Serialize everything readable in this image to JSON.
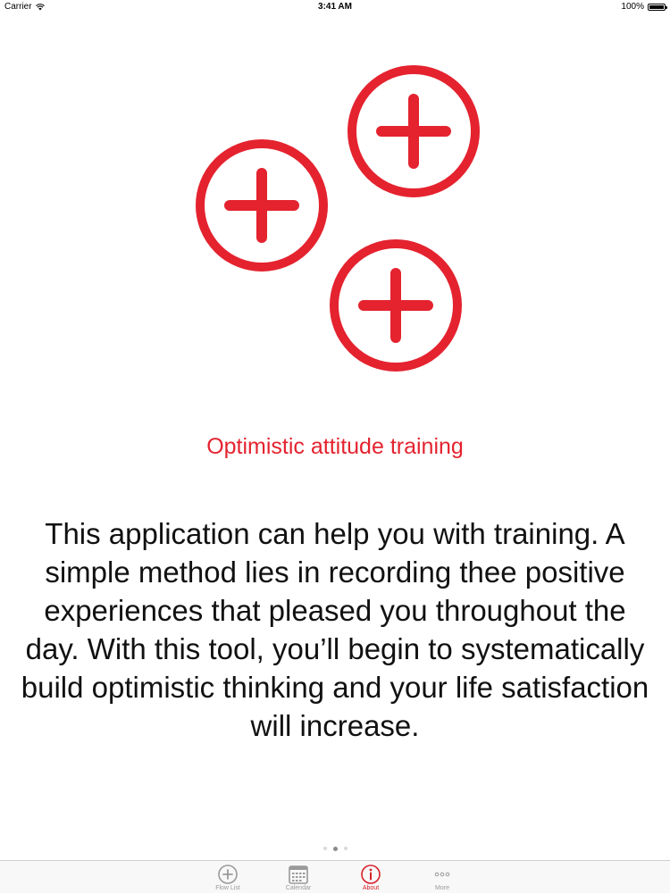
{
  "status_bar": {
    "carrier": "Carrier",
    "time": "3:41 AM",
    "battery": "100%",
    "battery_level": 1.0
  },
  "logo": {
    "icon": "three-plus-circles-icon",
    "color": "#e4232f"
  },
  "title": "Optimistic attitude training",
  "description": "This application can help you with training. A simple method lies in recording thee positive experiences that pleased you throughout the day. With this tool, you’ll begin to systematically build optimistic thinking and your life satisfaction will increase.",
  "page_dots": {
    "count": 3,
    "active_index": 1
  },
  "tab_bar": {
    "tabs": [
      {
        "label": "Flow List",
        "icon": "plus-circle-icon",
        "active": false
      },
      {
        "label": "Calendar",
        "icon": "calendar-icon",
        "active": false
      },
      {
        "label": "About",
        "icon": "info-icon",
        "active": true
      },
      {
        "label": "More",
        "icon": "more-icon",
        "active": false
      }
    ],
    "active_color": "#d81f2a",
    "inactive_color": "#9a9a9a"
  }
}
